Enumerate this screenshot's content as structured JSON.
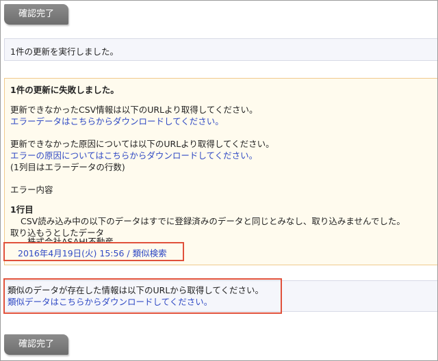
{
  "buttons": {
    "confirm_top": "確認完了",
    "confirm_bottom": "確認完了"
  },
  "success": {
    "message": "1件の更新を実行しました。"
  },
  "error": {
    "title": "1件の更新に失敗しました。",
    "csv_info": "更新できなかったCSV情報は以下のURLより取得してください。",
    "csv_link": "エラーデータはこちらからダウンロードしてください。",
    "cause_info": "更新できなかった原因については以下のURLより取得してください。",
    "cause_link": "エラーの原因についてはこちらからダウンロードしてください。",
    "cause_note": "(1列目はエラーデータの行数)",
    "details_label": "エラー内容",
    "row_label": "1行目",
    "row_message": "CSV読み込み中の以下のデータはすでに登録済みのデータと同じとみなし、取り込みませんでした。",
    "import_label": "取り込もうとしたデータ",
    "company": "株式会社ASAHI不動産",
    "date_link": "2016年4月19日(火) 15:56 / 類似検索"
  },
  "similar": {
    "info": "類似のデータが存在した情報は以下のURLから取得してください。",
    "link": "類似データはこちらからダウンロードしてください。"
  },
  "colors": {
    "link": "#2f49c4",
    "highlight": "#e0503a",
    "button": "#7a7a7a"
  }
}
